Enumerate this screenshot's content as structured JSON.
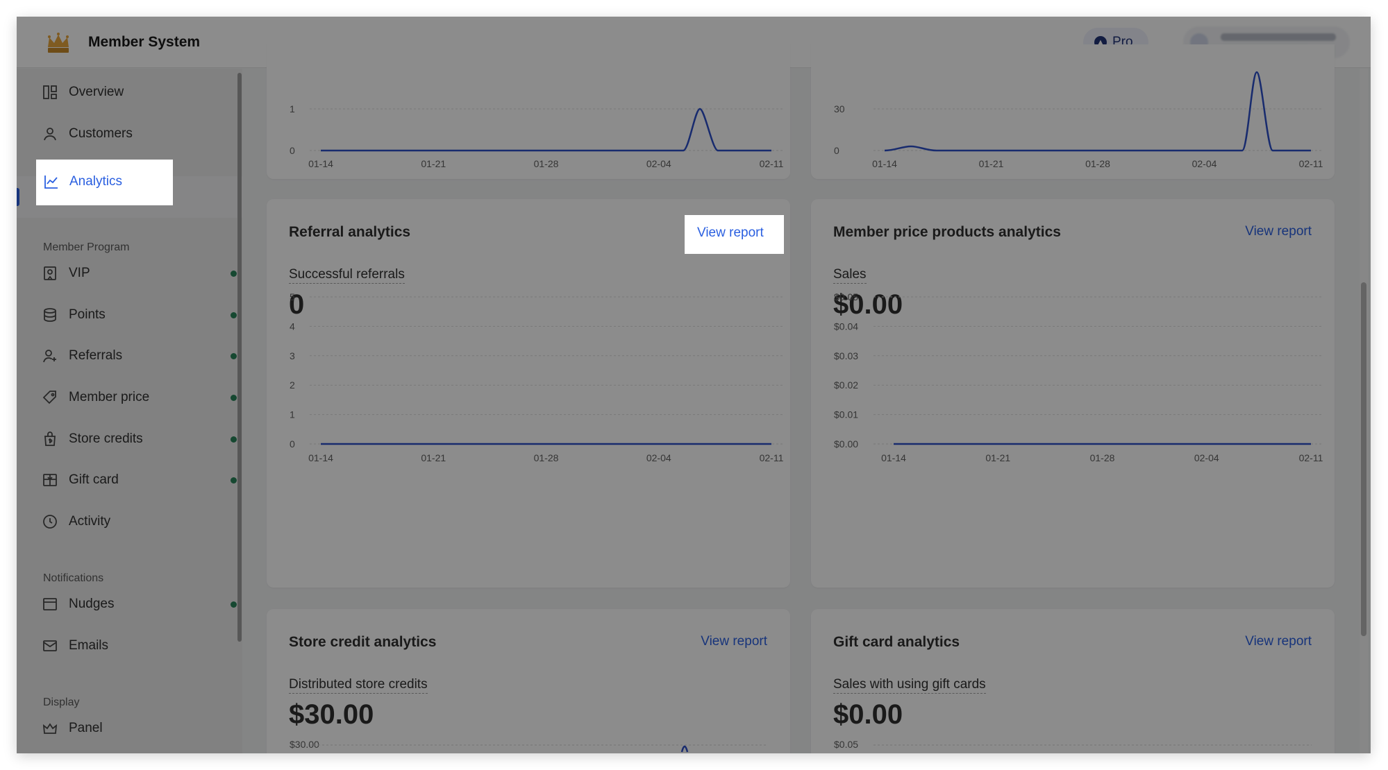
{
  "app": {
    "title": "Member System",
    "plan_badge": "Pro"
  },
  "sidebar": {
    "items_top": [
      {
        "label": "Overview",
        "icon": "overview-icon"
      },
      {
        "label": "Customers",
        "icon": "customers-icon"
      },
      {
        "label": "Analytics",
        "icon": "analytics-icon",
        "active": true
      }
    ],
    "section_program": "Member Program",
    "items_program": [
      {
        "label": "VIP",
        "icon": "vip-icon",
        "enabled": true
      },
      {
        "label": "Points",
        "icon": "points-icon",
        "enabled": true
      },
      {
        "label": "Referrals",
        "icon": "referrals-icon",
        "enabled": true
      },
      {
        "label": "Member price",
        "icon": "tag-icon",
        "enabled": true
      },
      {
        "label": "Store credits",
        "icon": "store-credits-icon",
        "enabled": true
      },
      {
        "label": "Gift card",
        "icon": "gift-card-icon",
        "enabled": true
      },
      {
        "label": "Activity",
        "icon": "clock-icon",
        "enabled": false
      }
    ],
    "section_notifications": "Notifications",
    "items_notifications": [
      {
        "label": "Nudges",
        "icon": "nudges-icon",
        "enabled": true
      },
      {
        "label": "Emails",
        "icon": "email-icon",
        "enabled": false
      }
    ],
    "section_display": "Display",
    "items_display": [
      {
        "label": "Panel",
        "icon": "panel-icon"
      }
    ]
  },
  "cards": {
    "top_left": {
      "y_ticks": [
        "1",
        "0"
      ]
    },
    "top_right": {
      "y_ticks": [
        "30",
        "0"
      ]
    },
    "referral": {
      "title": "Referral analytics",
      "link": "View report",
      "metric_label": "Successful referrals",
      "metric_value": "0"
    },
    "member_price": {
      "title": "Member price products analytics",
      "link": "View report",
      "metric_label": "Sales",
      "metric_value": "$0.00"
    },
    "store_credit": {
      "title": "Store credit analytics",
      "link": "View report",
      "metric_label": "Distributed store credits",
      "metric_value": "$30.00",
      "first_tick": "$30.00"
    },
    "gift_card": {
      "title": "Gift card analytics",
      "link": "View report",
      "metric_label": "Sales with using gift cards",
      "metric_value": "$0.00",
      "first_tick": "$0.05"
    }
  },
  "chart_data": [
    {
      "type": "line",
      "x": [
        "01-14",
        "01-21",
        "01-28",
        "02-04",
        "02-11"
      ],
      "series": [
        {
          "values_note": "",
          "values": [
            0,
            0,
            0,
            0,
            1,
            0
          ]
        }
      ],
      "ylim": [
        0,
        1
      ],
      "yticks": [
        "1",
        "0"
      ],
      "peak_x_index": 4,
      "color": "#2c4fc9"
    },
    {
      "type": "line",
      "x": [
        "01-14",
        "01-21",
        "01-28",
        "02-04",
        "02-11"
      ],
      "series": [
        {
          "values": [
            0,
            1,
            0,
            0,
            0,
            50,
            0
          ]
        }
      ],
      "ylim": [
        0,
        30
      ],
      "yticks": [
        "30",
        "0"
      ],
      "color": "#2c4fc9"
    },
    {
      "type": "line",
      "x": [
        "01-14",
        "01-21",
        "01-28",
        "02-04",
        "02-11"
      ],
      "series": [
        {
          "values": [
            0,
            0,
            0,
            0,
            0
          ]
        }
      ],
      "ylim": [
        0,
        5
      ],
      "yticks": [
        "5",
        "4",
        "3",
        "2",
        "1",
        "0"
      ],
      "color": "#2c4fc9"
    },
    {
      "type": "line",
      "x": [
        "01-14",
        "01-21",
        "01-28",
        "02-04",
        "02-11"
      ],
      "series": [
        {
          "values": [
            0,
            0,
            0,
            0,
            0
          ]
        }
      ],
      "ylim": [
        0,
        0.05
      ],
      "yticks": [
        "$0.05",
        "$0.04",
        "$0.03",
        "$0.02",
        "$0.01",
        "$0.00"
      ],
      "color": "#2c4fc9"
    }
  ]
}
